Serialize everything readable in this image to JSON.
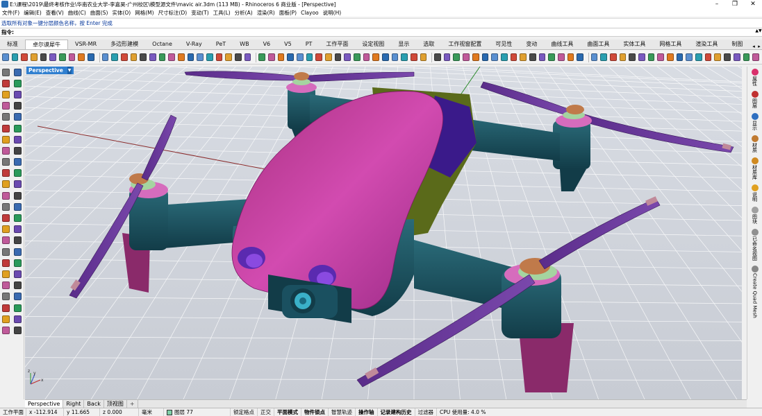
{
  "window": {
    "title": "E:\\课程\\2019\\最终考核作业\\华南农业大学-李嘉昊-广州校区\\模型源文件\\mavic air.3dm (113 MB) - Rhinoceros 6 商业版 - [Perspective]",
    "controls": [
      "–",
      "❐",
      "✕"
    ]
  },
  "menu": [
    "文件(F)",
    "编辑(E)",
    "查看(V)",
    "曲线(C)",
    "曲面(S)",
    "实体(O)",
    "网格(M)",
    "尺寸标注(D)",
    "变动(T)",
    "工具(L)",
    "分析(A)",
    "渲染(R)",
    "面板(P)",
    "Clayoo",
    "说明(H)"
  ],
  "command": {
    "history": "选取所有对象一键分层颜色名称，按 Enter 完成",
    "prompt_label": "指令:",
    "input_value": ""
  },
  "tabs": [
    "标准",
    "卓尔谟犀牛",
    "VSR-MR",
    "多边形建模",
    "Octane",
    "V-Ray",
    "PeT",
    "WB",
    "V6",
    "V5",
    "PT",
    "工作平面",
    "设定视图",
    "显示",
    "选取",
    "工作视窗配置",
    "可见性",
    "变动",
    "曲线工具",
    "曲面工具",
    "实体工具",
    "网格工具",
    "渲染工具",
    "制图"
  ],
  "active_tab_index": 1,
  "viewport": {
    "label": "Perspective",
    "dropdown": "▼"
  },
  "right_panel": [
    {
      "label": "属性",
      "icon_color": "#d9306b"
    },
    {
      "label": "图层",
      "icon_color": "#c03030"
    },
    {
      "label": "显示",
      "icon_color": "#2e6fc0"
    },
    {
      "label": "材质",
      "icon_color": "#c07a30"
    },
    {
      "label": "材质库",
      "icon_color": "#d08a20"
    },
    {
      "label": "说明",
      "icon_color": "#e0a020"
    },
    {
      "label": "图块",
      "icon_color": "#a0a0a0"
    },
    {
      "label": "已命名视图",
      "icon_color": "#909090"
    },
    {
      "label": "Create Quad Mesh",
      "icon_color": "#888888"
    }
  ],
  "viewport_tabs": [
    "Perspective",
    "Right",
    "Back",
    "顶视图",
    "+"
  ],
  "active_viewport_tab": 0,
  "status": {
    "plane": "工作平面",
    "x": "x -112.914",
    "y": "y 11.665",
    "z": "z 0.000",
    "unit": "毫米",
    "layer": "图层 77",
    "toggles": [
      "锁定格点",
      "正交",
      "平面模式",
      "物件锁点",
      "智慧轨迹",
      "操作轴",
      "记录建构历史",
      "过滤器"
    ],
    "bold_toggles": [
      2,
      3,
      5,
      6
    ],
    "cpu": "CPU 使用量: 4.0 %"
  },
  "colors": {
    "body_pink": "#c0399a",
    "arm_teal": "#1a4f5e",
    "propeller_purple": "#6a3a9a",
    "hub_orange": "#c07a4a",
    "lens_cyan": "#3ab0c8",
    "olive": "#5a6a1a",
    "viewport_bg": "#cfd3da",
    "grid_line": "#ffffff",
    "accent_blue": "#2f7fd0"
  }
}
